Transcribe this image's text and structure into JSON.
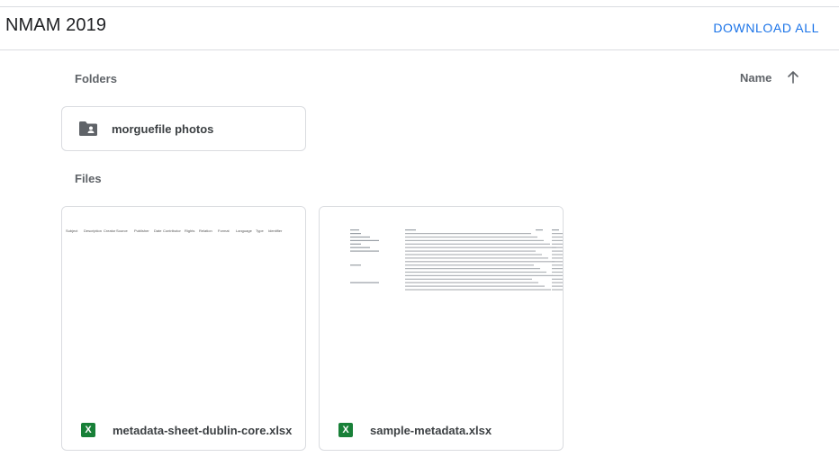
{
  "header": {
    "title": "NMAM 2019",
    "download_all": "DOWNLOAD ALL"
  },
  "folders_section": {
    "label": "Folders",
    "items": [
      {
        "name": "morguefile photos",
        "icon": "shared-folder-icon"
      }
    ]
  },
  "sort": {
    "label": "Name",
    "icon": "arrow-up-icon",
    "direction": "ascending"
  },
  "files_section": {
    "label": "Files",
    "items": [
      {
        "name": "metadata-sheet-dublin-core.xlsx",
        "icon": "excel-icon",
        "icon_letter": "X",
        "preview_headers": [
          "Subject",
          "Description",
          "Creator",
          "Source",
          "Publisher",
          "Date",
          "Contributor",
          "Rights",
          "Relation",
          "Format",
          "Language",
          "Type",
          "Identifier"
        ]
      },
      {
        "name": "sample-metadata.xlsx",
        "icon": "excel-icon",
        "icon_letter": "X"
      }
    ]
  },
  "colors": {
    "accent": "#1a73e8",
    "excel_green": "#188038",
    "border": "#dadce0",
    "label_gray": "#5f6368"
  }
}
